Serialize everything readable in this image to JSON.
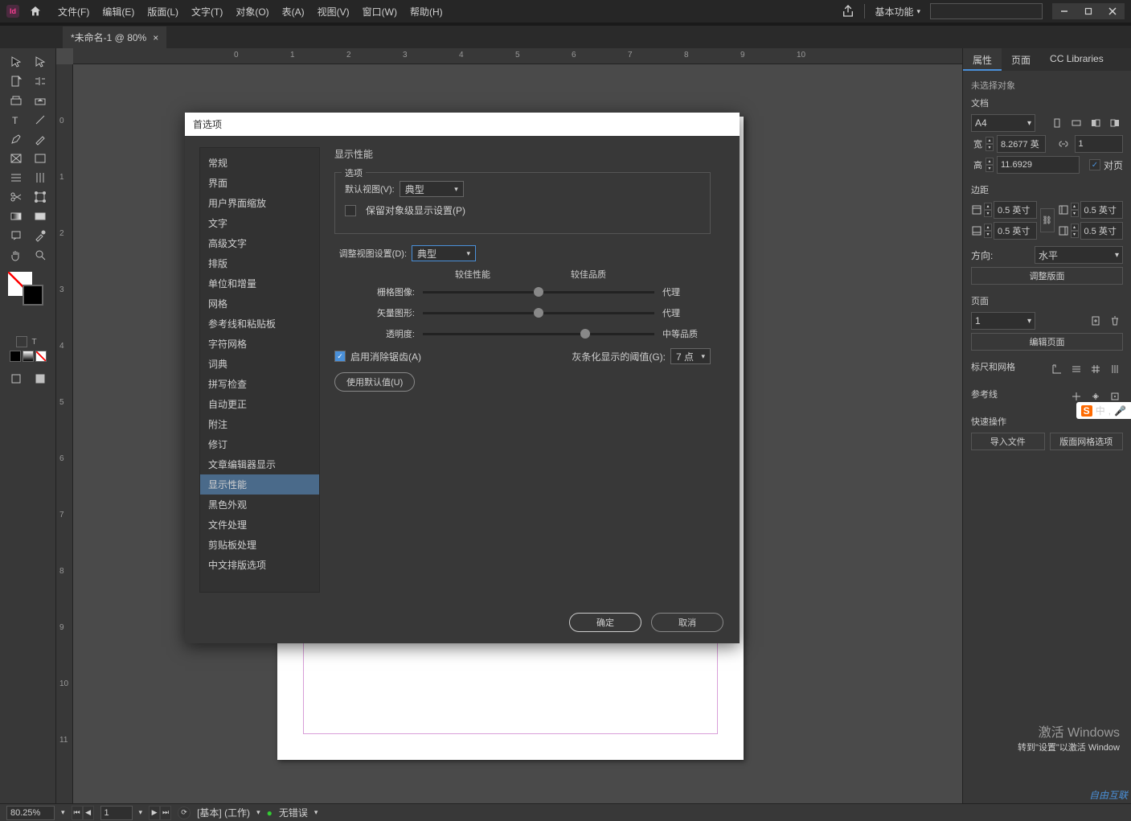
{
  "titlebar": {
    "menus": [
      "文件(F)",
      "编辑(E)",
      "版面(L)",
      "文字(T)",
      "对象(O)",
      "表(A)",
      "视图(V)",
      "窗口(W)",
      "帮助(H)"
    ],
    "workspace": "基本功能"
  },
  "tab": {
    "title": "*未命名-1 @ 80%"
  },
  "ruler": {
    "h": [
      {
        "v": "0",
        "p": 200
      },
      {
        "v": "1",
        "p": 270
      },
      {
        "v": "2",
        "p": 340
      },
      {
        "v": "3",
        "p": 410
      },
      {
        "v": "4",
        "p": 480
      },
      {
        "v": "5",
        "p": 550
      },
      {
        "v": "6",
        "p": 620
      },
      {
        "v": "7",
        "p": 690
      },
      {
        "v": "8",
        "p": 760
      },
      {
        "v": "9",
        "p": 830
      },
      {
        "v": "10",
        "p": 900
      }
    ],
    "v": [
      {
        "v": "0",
        "p": 65
      },
      {
        "v": "1",
        "p": 135
      },
      {
        "v": "2",
        "p": 205
      },
      {
        "v": "3",
        "p": 275
      },
      {
        "v": "4",
        "p": 345
      },
      {
        "v": "5",
        "p": 415
      },
      {
        "v": "6",
        "p": 485
      },
      {
        "v": "7",
        "p": 555
      },
      {
        "v": "8",
        "p": 625
      },
      {
        "v": "9",
        "p": 695
      },
      {
        "v": "10",
        "p": 765
      },
      {
        "v": "11",
        "p": 835
      }
    ]
  },
  "panel": {
    "tabs": [
      "属性",
      "页面",
      "CC Libraries"
    ],
    "no_sel": "未选择对象",
    "doc": {
      "head": "文档",
      "size": "A4",
      "w_lbl": "宽",
      "w": "8.2677 英",
      "h_lbl": "高",
      "h": "11.6929",
      "facing_lbl": "对页",
      "cols": "1"
    },
    "margins": {
      "head": "边距",
      "val": "0.5 英寸",
      "orient_lbl": "方向:",
      "orient": "水平",
      "adjust_btn": "调整版面"
    },
    "pages": {
      "head": "页面",
      "cur": "1",
      "edit_btn": "编辑页面"
    },
    "rulers": {
      "head": "标尺和网格"
    },
    "guides": {
      "head": "参考线"
    },
    "quick": {
      "head": "快速操作",
      "import_btn": "导入文件",
      "grid_btn": "版面网格选项"
    }
  },
  "dialog": {
    "title": "首选项",
    "sidebar": [
      "常规",
      "界面",
      "用户界面缩放",
      "文字",
      "高级文字",
      "排版",
      "单位和增量",
      "网格",
      "参考线和粘贴板",
      "字符网格",
      "词典",
      "拼写检查",
      "自动更正",
      "附注",
      "修订",
      "文章编辑器显示",
      "显示性能",
      "黑色外观",
      "文件处理",
      "剪贴板处理",
      "中文排版选项"
    ],
    "active_idx": 16,
    "heading": "显示性能",
    "opts": {
      "legend": "选项",
      "default_view_lbl": "默认视图(V):",
      "default_view": "典型",
      "preserve_lbl": "保留对象级显示设置(P)"
    },
    "adjust": {
      "lbl": "调整视图设置(D):",
      "val": "典型",
      "perf_lbl": "较佳性能",
      "qual_lbl": "较佳品质",
      "sliders": [
        {
          "lbl": "栅格图像:",
          "end": "代理",
          "pos": 50
        },
        {
          "lbl": "矢量图形:",
          "end": "代理",
          "pos": 50
        },
        {
          "lbl": "透明度:",
          "end": "中等品质",
          "pos": 70
        }
      ],
      "aa_lbl": "启用消除锯齿(A)",
      "gray_lbl": "灰条化显示的阈值(G):",
      "gray_val": "7 点",
      "defaults_btn": "使用默认值(U)"
    },
    "ok": "确定",
    "cancel": "取消"
  },
  "status": {
    "zoom": "80.25%",
    "page": "1",
    "style": "[基本]  (工作)",
    "errors": "无错误"
  },
  "watermark": {
    "l1": "激活 Windows",
    "l2": "转到\"设置\"以激活 Window"
  },
  "corner": "自由互联",
  "ime": "中"
}
